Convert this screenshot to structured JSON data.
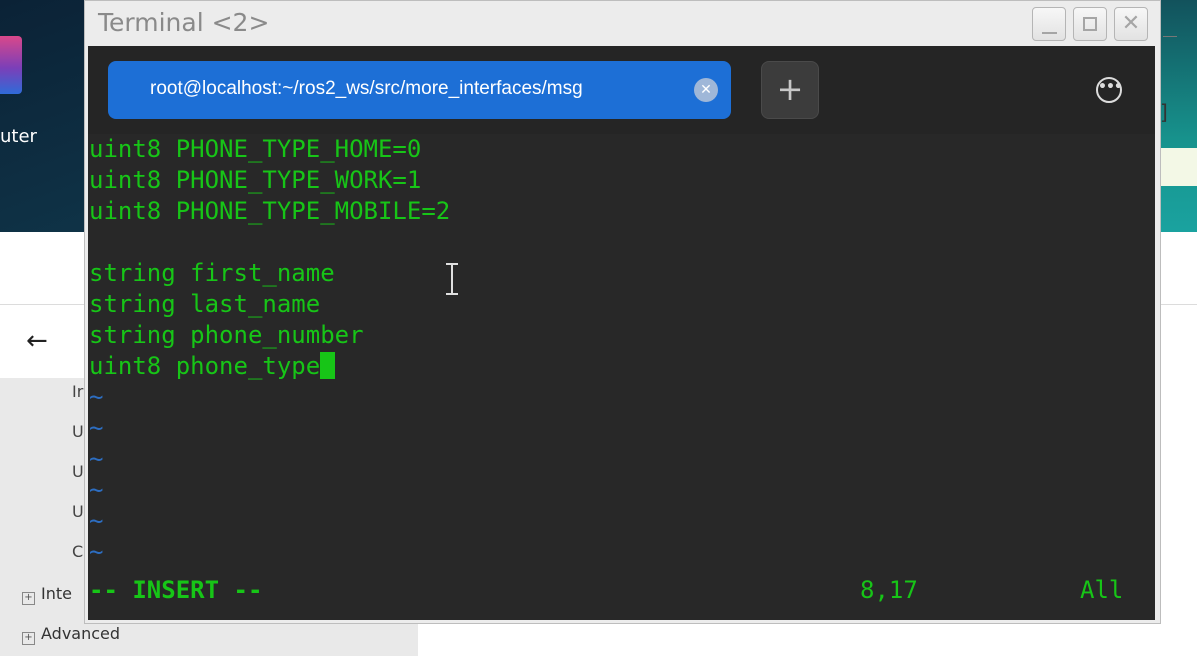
{
  "desktop": {
    "icon_label": "uter"
  },
  "background_app": {
    "back_arrow": "←",
    "list_items": [
      "Ir",
      "U",
      "U",
      "U",
      "C"
    ],
    "tree_items": [
      {
        "toggle": "+",
        "label": "Inte"
      },
      {
        "toggle": "+",
        "label": "Advanced"
      }
    ],
    "right_control": "]"
  },
  "window": {
    "title": "Terminal <2>",
    "controls": {
      "close": "✕"
    }
  },
  "tabs": [
    {
      "label": "root@localhost:~/ros2_ws/src/more_interfaces/msg",
      "active": true,
      "close": "✕"
    }
  ],
  "new_tab_label": "+",
  "menu_label": "•••",
  "editor": {
    "lines": [
      "uint8 PHONE_TYPE_HOME=0",
      "uint8 PHONE_TYPE_WORK=1",
      "uint8 PHONE_TYPE_MOBILE=2",
      "",
      "string first_name",
      "string last_name",
      "string phone_number",
      "uint8 phone_type"
    ],
    "empty_line_marker": "~",
    "mode": "-- INSERT --",
    "position": "8,17",
    "scroll": "All"
  },
  "colors": {
    "terminal_bg": "#282828",
    "text": "#17c517",
    "tilde": "#2d6ec2",
    "tab_active": "#1d6fd6"
  }
}
